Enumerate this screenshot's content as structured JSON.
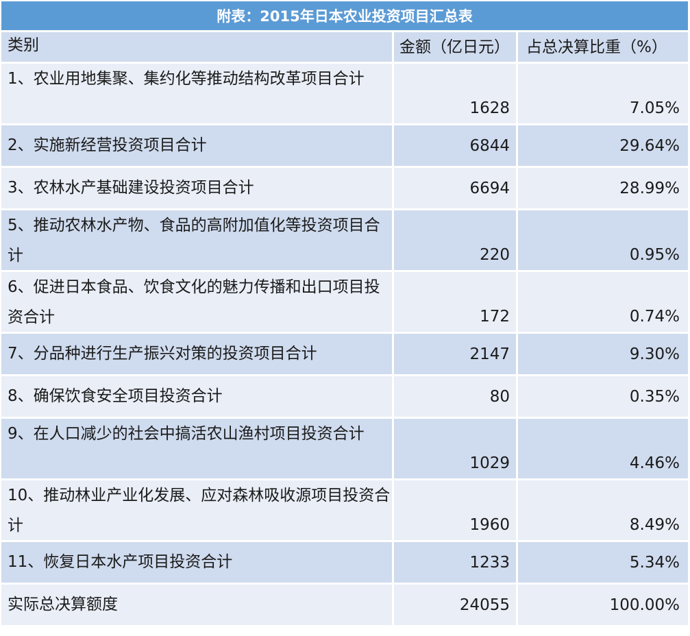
{
  "table": {
    "title": "附表：2015年日本农业投资项目汇总表",
    "headers": [
      "类别",
      "金额（亿日元）",
      "占总决算比重（%）"
    ],
    "rows": [
      {
        "category": "1、农业用地集聚、集约化等推动结构改革项目合计",
        "amount": "1628",
        "share": "7.05%"
      },
      {
        "category": "2、实施新经营投资项目合计",
        "amount": "6844",
        "share": "29.64%"
      },
      {
        "category": "3、农林水产基础建设投资项目合计",
        "amount": "6694",
        "share": "28.99%"
      },
      {
        "category": "5、推动农林水产物、食品的高附加值化等投资项目合计",
        "amount": "220",
        "share": "0.95%"
      },
      {
        "category": "6、促进日本食品、饮食文化的魅力传播和出口项目投资合计",
        "amount": "172",
        "share": "0.74%"
      },
      {
        "category": "7、分品种进行生产振兴对策的投资项目合计",
        "amount": "2147",
        "share": "9.30%"
      },
      {
        "category": "8、确保饮食安全项目投资合计",
        "amount": "80",
        "share": "0.35%"
      },
      {
        "category": "9、在人口减少的社会中搞活农山渔村项目投资合计",
        "amount": "1029",
        "share": "4.46%"
      },
      {
        "category": "10、推动林业产业化发展、应对森林吸收源项目投资合计",
        "amount": "1960",
        "share": "8.49%"
      },
      {
        "category": "11、恢复日本水产项目投资合计",
        "amount": "1233",
        "share": "5.34%"
      },
      {
        "category": "实际总决算额度",
        "amount": "24055",
        "share": "100.00%"
      }
    ]
  },
  "colors": {
    "title_bg": "#5b9bd5",
    "row_dark": "#cfdbee",
    "row_light": "#e9eef7"
  }
}
